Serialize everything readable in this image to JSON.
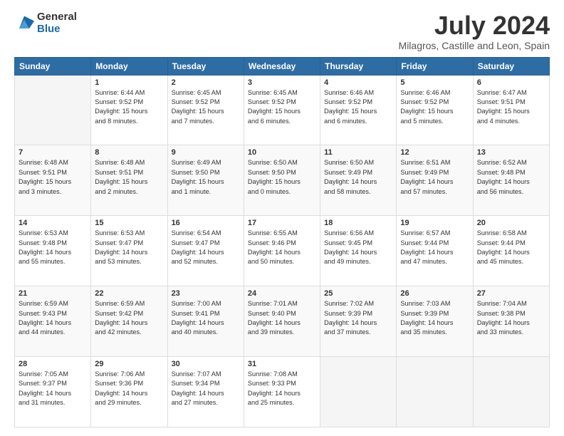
{
  "logo": {
    "general": "General",
    "blue": "Blue"
  },
  "header": {
    "month": "July 2024",
    "location": "Milagros, Castille and Leon, Spain"
  },
  "weekdays": [
    "Sunday",
    "Monday",
    "Tuesday",
    "Wednesday",
    "Thursday",
    "Friday",
    "Saturday"
  ],
  "weeks": [
    [
      {
        "day": "",
        "info": ""
      },
      {
        "day": "1",
        "info": "Sunrise: 6:44 AM\nSunset: 9:52 PM\nDaylight: 15 hours\nand 8 minutes."
      },
      {
        "day": "2",
        "info": "Sunrise: 6:45 AM\nSunset: 9:52 PM\nDaylight: 15 hours\nand 7 minutes."
      },
      {
        "day": "3",
        "info": "Sunrise: 6:45 AM\nSunset: 9:52 PM\nDaylight: 15 hours\nand 6 minutes."
      },
      {
        "day": "4",
        "info": "Sunrise: 6:46 AM\nSunset: 9:52 PM\nDaylight: 15 hours\nand 6 minutes."
      },
      {
        "day": "5",
        "info": "Sunrise: 6:46 AM\nSunset: 9:52 PM\nDaylight: 15 hours\nand 5 minutes."
      },
      {
        "day": "6",
        "info": "Sunrise: 6:47 AM\nSunset: 9:51 PM\nDaylight: 15 hours\nand 4 minutes."
      }
    ],
    [
      {
        "day": "7",
        "info": "Sunrise: 6:48 AM\nSunset: 9:51 PM\nDaylight: 15 hours\nand 3 minutes."
      },
      {
        "day": "8",
        "info": "Sunrise: 6:48 AM\nSunset: 9:51 PM\nDaylight: 15 hours\nand 2 minutes."
      },
      {
        "day": "9",
        "info": "Sunrise: 6:49 AM\nSunset: 9:50 PM\nDaylight: 15 hours\nand 1 minute."
      },
      {
        "day": "10",
        "info": "Sunrise: 6:50 AM\nSunset: 9:50 PM\nDaylight: 15 hours\nand 0 minutes."
      },
      {
        "day": "11",
        "info": "Sunrise: 6:50 AM\nSunset: 9:49 PM\nDaylight: 14 hours\nand 58 minutes."
      },
      {
        "day": "12",
        "info": "Sunrise: 6:51 AM\nSunset: 9:49 PM\nDaylight: 14 hours\nand 57 minutes."
      },
      {
        "day": "13",
        "info": "Sunrise: 6:52 AM\nSunset: 9:48 PM\nDaylight: 14 hours\nand 56 minutes."
      }
    ],
    [
      {
        "day": "14",
        "info": "Sunrise: 6:53 AM\nSunset: 9:48 PM\nDaylight: 14 hours\nand 55 minutes."
      },
      {
        "day": "15",
        "info": "Sunrise: 6:53 AM\nSunset: 9:47 PM\nDaylight: 14 hours\nand 53 minutes."
      },
      {
        "day": "16",
        "info": "Sunrise: 6:54 AM\nSunset: 9:47 PM\nDaylight: 14 hours\nand 52 minutes."
      },
      {
        "day": "17",
        "info": "Sunrise: 6:55 AM\nSunset: 9:46 PM\nDaylight: 14 hours\nand 50 minutes."
      },
      {
        "day": "18",
        "info": "Sunrise: 6:56 AM\nSunset: 9:45 PM\nDaylight: 14 hours\nand 49 minutes."
      },
      {
        "day": "19",
        "info": "Sunrise: 6:57 AM\nSunset: 9:44 PM\nDaylight: 14 hours\nand 47 minutes."
      },
      {
        "day": "20",
        "info": "Sunrise: 6:58 AM\nSunset: 9:44 PM\nDaylight: 14 hours\nand 45 minutes."
      }
    ],
    [
      {
        "day": "21",
        "info": "Sunrise: 6:59 AM\nSunset: 9:43 PM\nDaylight: 14 hours\nand 44 minutes."
      },
      {
        "day": "22",
        "info": "Sunrise: 6:59 AM\nSunset: 9:42 PM\nDaylight: 14 hours\nand 42 minutes."
      },
      {
        "day": "23",
        "info": "Sunrise: 7:00 AM\nSunset: 9:41 PM\nDaylight: 14 hours\nand 40 minutes."
      },
      {
        "day": "24",
        "info": "Sunrise: 7:01 AM\nSunset: 9:40 PM\nDaylight: 14 hours\nand 39 minutes."
      },
      {
        "day": "25",
        "info": "Sunrise: 7:02 AM\nSunset: 9:39 PM\nDaylight: 14 hours\nand 37 minutes."
      },
      {
        "day": "26",
        "info": "Sunrise: 7:03 AM\nSunset: 9:39 PM\nDaylight: 14 hours\nand 35 minutes."
      },
      {
        "day": "27",
        "info": "Sunrise: 7:04 AM\nSunset: 9:38 PM\nDaylight: 14 hours\nand 33 minutes."
      }
    ],
    [
      {
        "day": "28",
        "info": "Sunrise: 7:05 AM\nSunset: 9:37 PM\nDaylight: 14 hours\nand 31 minutes."
      },
      {
        "day": "29",
        "info": "Sunrise: 7:06 AM\nSunset: 9:36 PM\nDaylight: 14 hours\nand 29 minutes."
      },
      {
        "day": "30",
        "info": "Sunrise: 7:07 AM\nSunset: 9:34 PM\nDaylight: 14 hours\nand 27 minutes."
      },
      {
        "day": "31",
        "info": "Sunrise: 7:08 AM\nSunset: 9:33 PM\nDaylight: 14 hours\nand 25 minutes."
      },
      {
        "day": "",
        "info": ""
      },
      {
        "day": "",
        "info": ""
      },
      {
        "day": "",
        "info": ""
      }
    ]
  ]
}
